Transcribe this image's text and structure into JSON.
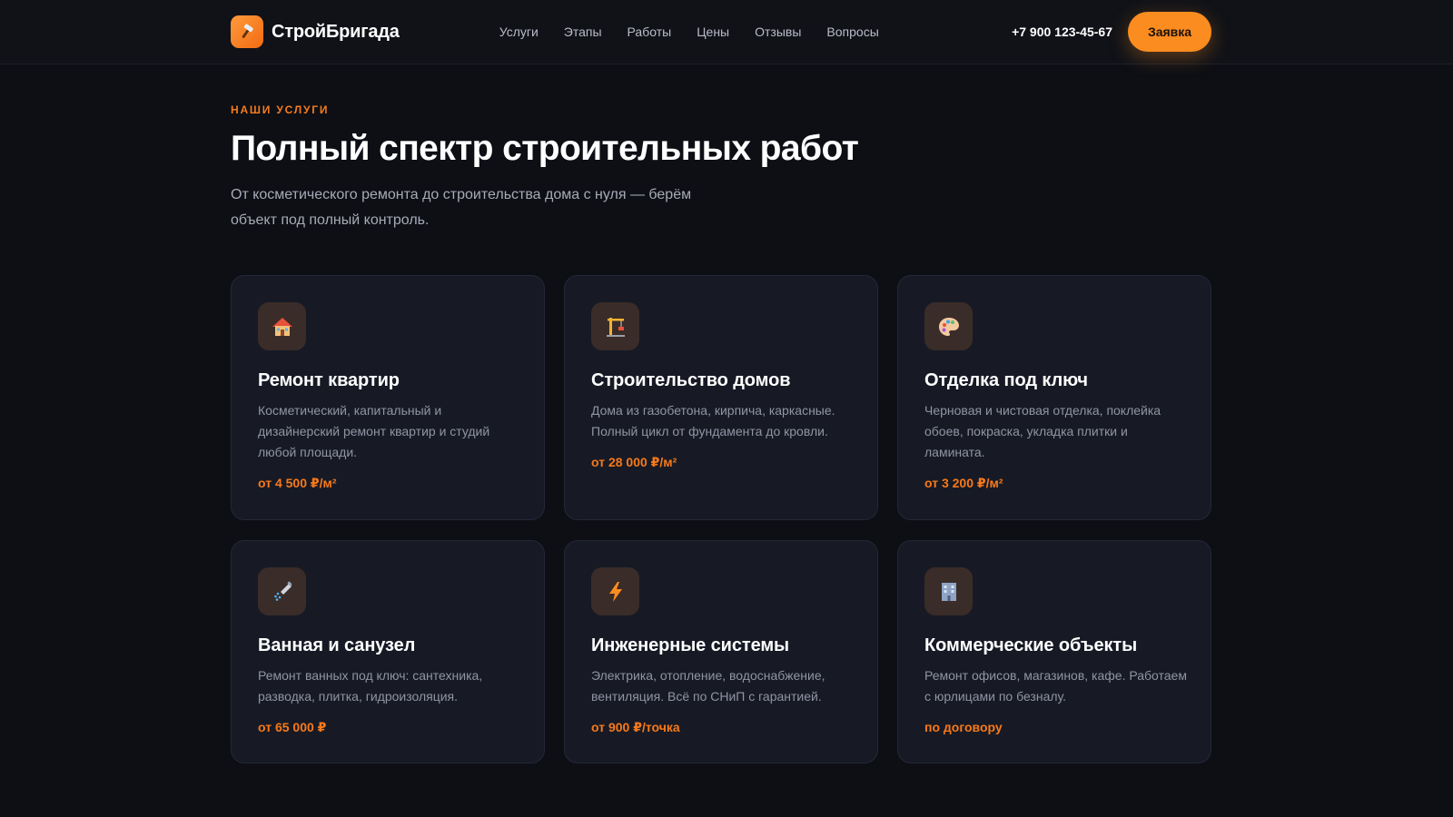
{
  "brand": {
    "name": "СтройБригада",
    "logo_icon": "hammer-icon",
    "accent": "#fb8c20"
  },
  "nav": {
    "links": [
      "Услуги",
      "Этапы",
      "Работы",
      "Цены",
      "Отзывы",
      "Вопросы"
    ],
    "phone": "+7 900 123-45-67",
    "cta_label": "Заявка"
  },
  "section": {
    "eyebrow": "НАШИ УСЛУГИ",
    "title": "Полный спектр строительных работ",
    "subtitle": "От косметического ремонта до строительства дома с нуля — берём объект под полный контроль."
  },
  "services": [
    {
      "icon": "house-icon",
      "title": "Ремонт квартир",
      "description": "Косметический, капитальный и дизайнерский ремонт квартир и студий любой площади.",
      "price": "от 4 500 ₽/м²"
    },
    {
      "icon": "crane-icon",
      "title": "Строительство домов",
      "description": "Дома из газобетона, кирпича, каркасные. Полный цикл от фундамента до кровли.",
      "price": "от 28 000 ₽/м²"
    },
    {
      "icon": "palette-icon",
      "title": "Отделка под ключ",
      "description": "Черновая и чистовая отделка, поклейка обоев, покраска, укладка плитки и ламината.",
      "price": "от 3 200 ₽/м²"
    },
    {
      "icon": "shower-icon",
      "title": "Ванная и санузел",
      "description": "Ремонт ванных под ключ: сантехника, разводка, плитка, гидроизоляция.",
      "price": "от 65 000 ₽"
    },
    {
      "icon": "lightning-icon",
      "title": "Инженерные системы",
      "description": "Электрика, отопление, водоснабжение, вентиляция. Всё по СНиП с гарантией.",
      "price": "от 900 ₽/точка"
    },
    {
      "icon": "office-building-icon",
      "title": "Коммерческие объекты",
      "description": "Ремонт офисов, магазинов, кафе. Работаем с юрлицами по безналу.",
      "price": "по договору"
    }
  ]
}
